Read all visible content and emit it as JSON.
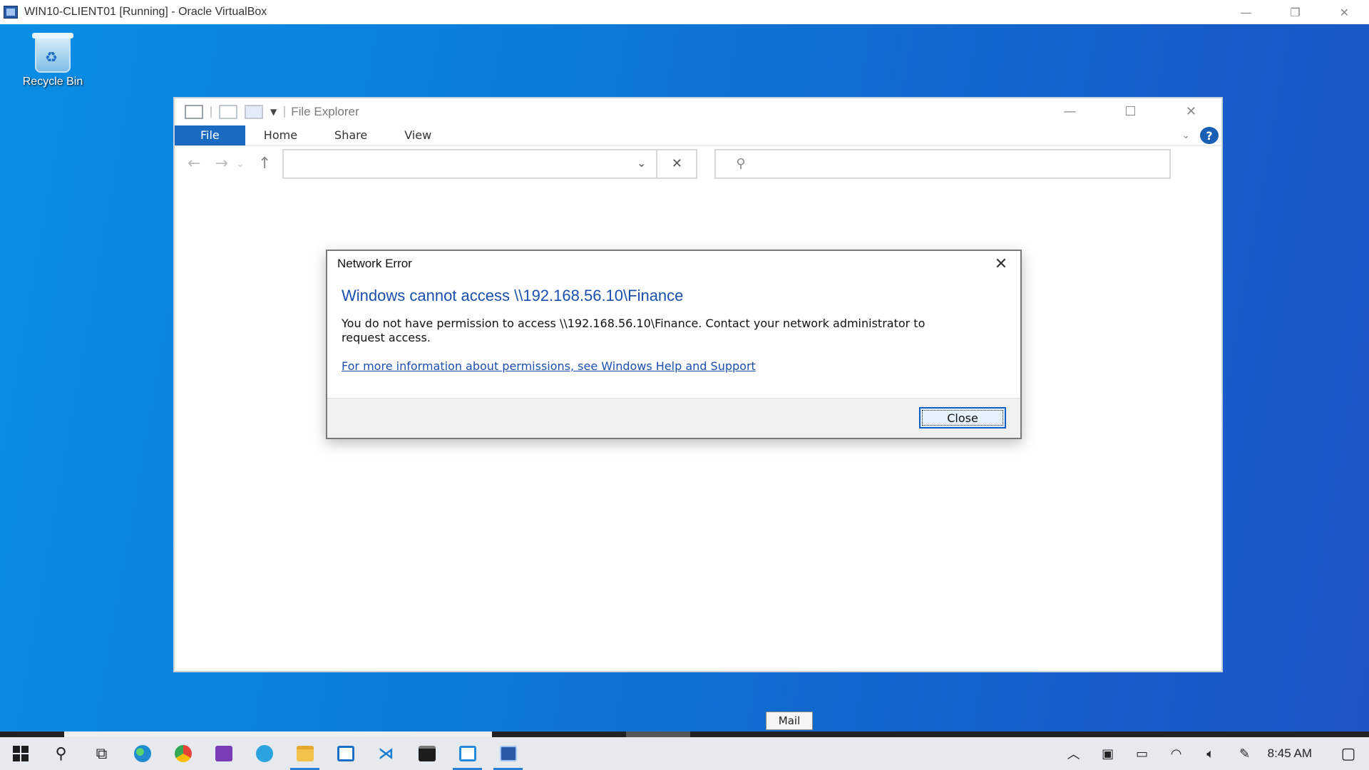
{
  "host": {
    "title": "WIN10-CLIENT01 [Running] - Oracle VirtualBox",
    "icon": "virtualbox-icon",
    "controls": {
      "minimize": "—",
      "restore": "❐",
      "close": "✕"
    }
  },
  "desktop": {
    "icons": [
      {
        "label": "Recycle Bin",
        "icon": "recycle-bin-icon"
      }
    ]
  },
  "explorer": {
    "title": "File Explorer",
    "ribbon_tabs": [
      "File",
      "Home",
      "Share",
      "View"
    ],
    "address_value": "",
    "search_value": "",
    "controls": {
      "minimize": "—",
      "maximize": "☐",
      "close": "✕"
    },
    "help_label": "?"
  },
  "dialog": {
    "title": "Network Error",
    "heading": "Windows cannot access \\\\192.168.56.10\\Finance",
    "message": "You do not have permission to access \\\\192.168.56.10\\Finance. Contact your network administrator to request access.",
    "link": "For more information about permissions, see Windows Help and Support",
    "button": "Close"
  },
  "tooltip": {
    "text": "Mail"
  },
  "taskbar": {
    "pinned": [
      {
        "name": "start-button",
        "icon": "windows-logo-icon"
      },
      {
        "name": "search-button",
        "icon": "search-icon"
      },
      {
        "name": "task-view-button",
        "icon": "task-view-icon"
      },
      {
        "name": "edge-button",
        "icon": "edge-icon",
        "color": "#1f8ad2"
      },
      {
        "name": "chrome-button",
        "icon": "chrome-icon",
        "color": "#e84335"
      },
      {
        "name": "visual-studio-button",
        "icon": "visual-studio-icon",
        "color": "#7b3db5"
      },
      {
        "name": "telegram-button",
        "icon": "telegram-icon",
        "color": "#2aa3de"
      },
      {
        "name": "file-explorer-button",
        "icon": "folder-icon",
        "color": "#f2c24b",
        "active": true
      },
      {
        "name": "app-button",
        "icon": "app-icon",
        "color": "#1e6fc7"
      },
      {
        "name": "vscode-button",
        "icon": "vscode-icon",
        "color": "#1a7fd4"
      },
      {
        "name": "terminal-button",
        "icon": "terminal-icon",
        "color": "#1c1c1c"
      },
      {
        "name": "vs-installer-button",
        "icon": "vs-installer-icon",
        "color": "#2b8ad8",
        "active": true
      },
      {
        "name": "virtualbox-button",
        "icon": "virtualbox-icon",
        "color": "#2a5aa6",
        "active": true
      }
    ],
    "clock": "8:45 AM"
  }
}
